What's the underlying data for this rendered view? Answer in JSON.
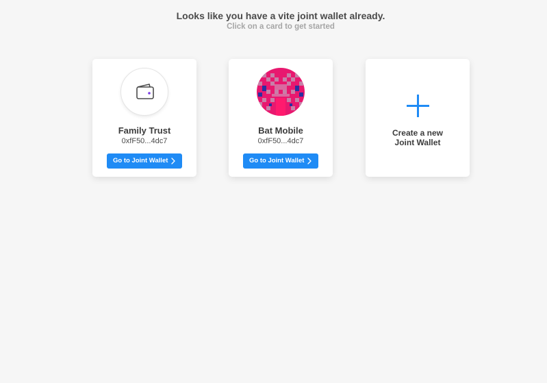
{
  "header": {
    "title": "Looks like you have a vite joint wallet already.",
    "subtitle": "Click on a card to get started"
  },
  "wallets": [
    {
      "name": "Family Trust",
      "address": "0xfF50...4dc7",
      "button_label": "Go to Joint Wallet",
      "avatar": "wallet-icon"
    },
    {
      "name": "Bat Mobile",
      "address": "0xfF50...4dc7",
      "button_label": "Go to Joint Wallet",
      "avatar": "pixel-identicon"
    }
  ],
  "create_card": {
    "line1": "Create a new",
    "line2": "Joint Wallet",
    "icon": "plus-icon"
  },
  "colors": {
    "accent": "#1f8bf5",
    "identicon_pink": "#e8186f",
    "identicon_blue": "#2b2fa0",
    "background": "#f6f6f6"
  }
}
